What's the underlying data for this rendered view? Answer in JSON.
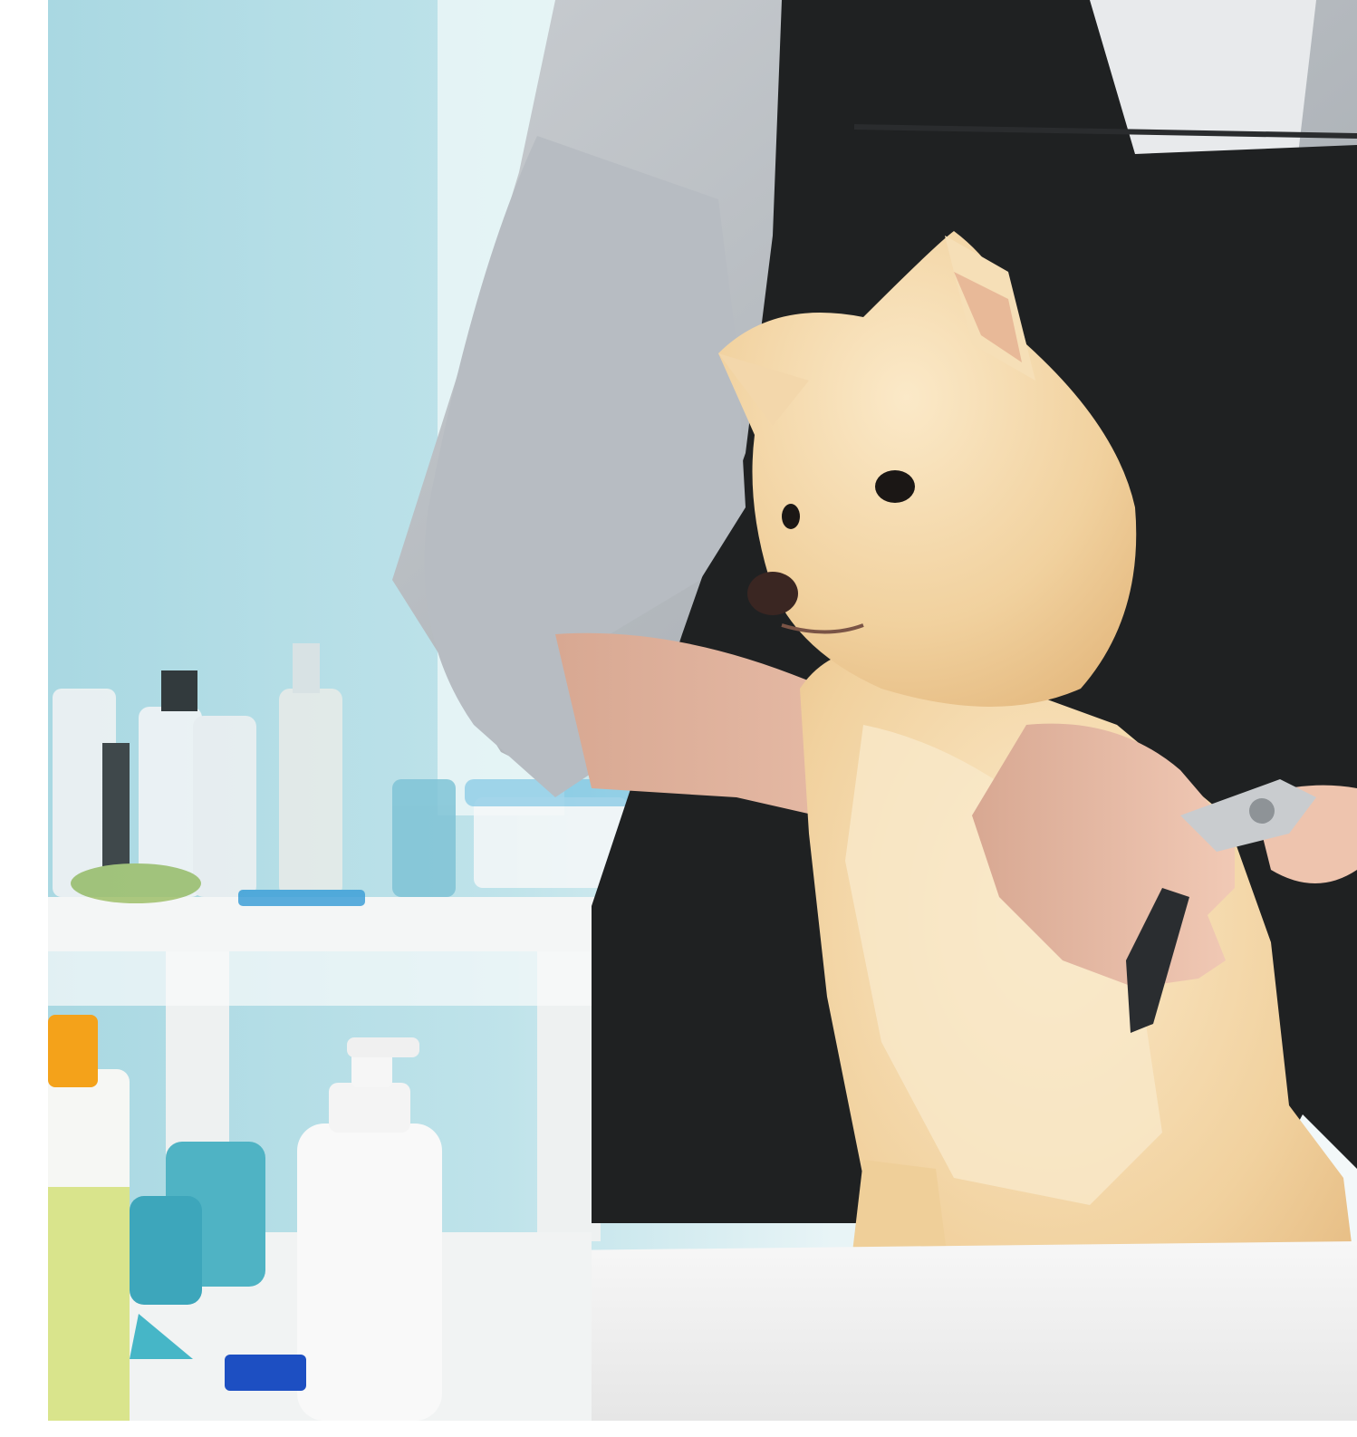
{
  "image": {
    "subject": "",
    "colors": {
      "wall": "#bfe3ea",
      "wall_light": "#e6f3f5",
      "shirt": "#b9bec4",
      "apron": "#1f2122",
      "dog_fur": "#f0cf9a",
      "dog_fur_light": "#f8e6c4",
      "skin": "#e9bba5",
      "towel": "#f2f2f2",
      "shelf": "#f4f6f6",
      "yellow_bottle_cap": "#f4a21a",
      "yellow_liquid": "#d9e48c",
      "cyan_curlers": "#4fb3c4",
      "blue_comb": "#1d4fc2"
    },
    "icons": [
      "photo-dog-icon",
      "clipper-icon",
      "pump-bottle-icon",
      "spray-bottle-icon"
    ]
  }
}
